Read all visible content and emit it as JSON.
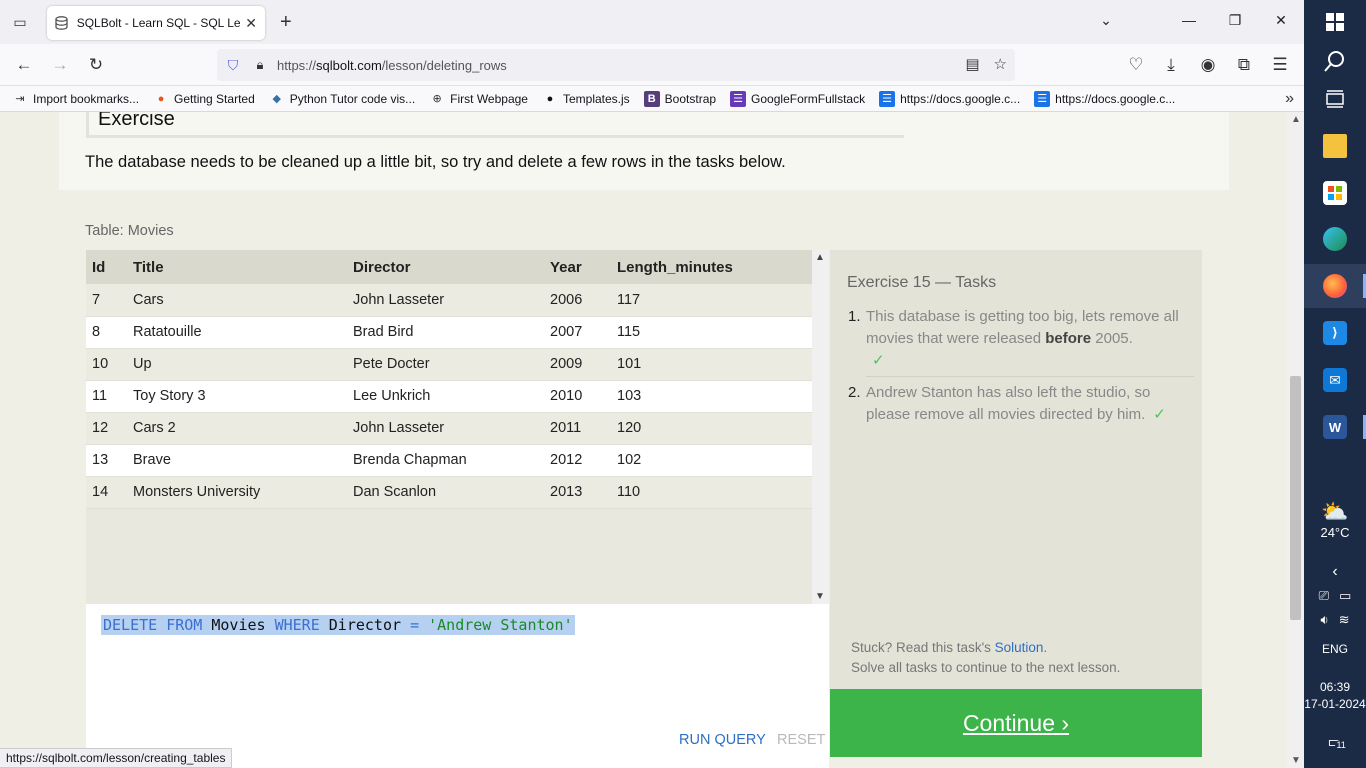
{
  "browser": {
    "tab_title": "SQLBolt - Learn SQL - SQL Less",
    "url_prefix": "https://",
    "url_host": "sqlbolt.com",
    "url_path": "/lesson/deleting_rows",
    "bookmarks": [
      {
        "label": "Import bookmarks...",
        "icon": "import-icon",
        "color": "#333333"
      },
      {
        "label": "Getting Started",
        "icon": "firefox-icon",
        "color": "#e8561f"
      },
      {
        "label": "Python Tutor code vis...",
        "icon": "python-icon",
        "color": "#3572a5"
      },
      {
        "label": "First Webpage",
        "icon": "globe-icon",
        "color": "#333333"
      },
      {
        "label": "Templates.js",
        "icon": "github-icon",
        "color": "#111111"
      },
      {
        "label": "Bootstrap",
        "icon": "bootstrap-icon",
        "color": "#563d7c"
      },
      {
        "label": "GoogleFormFullstack",
        "icon": "forms-icon",
        "color": "#673ab7"
      },
      {
        "label": "https://docs.google.c...",
        "icon": "docs-icon",
        "color": "#1a73e8"
      },
      {
        "label": "https://docs.google.c...",
        "icon": "docs-icon",
        "color": "#1a73e8"
      }
    ],
    "status_url": "https://sqlbolt.com/lesson/creating_tables"
  },
  "page": {
    "exercise_heading": "Exercise",
    "intro": "The database needs to be cleaned up a little bit, so try and delete a few rows in the tasks below.",
    "table_caption": "Table: Movies",
    "table": {
      "columns": [
        "Id",
        "Title",
        "Director",
        "Year",
        "Length_minutes"
      ],
      "rows": [
        [
          "7",
          "Cars",
          "John Lasseter",
          "2006",
          "117"
        ],
        [
          "8",
          "Ratatouille",
          "Brad Bird",
          "2007",
          "115"
        ],
        [
          "10",
          "Up",
          "Pete Docter",
          "2009",
          "101"
        ],
        [
          "11",
          "Toy Story 3",
          "Lee Unkrich",
          "2010",
          "103"
        ],
        [
          "12",
          "Cars 2",
          "John Lasseter",
          "2011",
          "120"
        ],
        [
          "13",
          "Brave",
          "Brenda Chapman",
          "2012",
          "102"
        ],
        [
          "14",
          "Monsters University",
          "Dan Scanlon",
          "2013",
          "110"
        ]
      ]
    },
    "query": {
      "kw1": "DELETE FROM",
      "table": "Movies",
      "kw2": "WHERE",
      "column": "Director",
      "op": "=",
      "value": "'Andrew Stanton'"
    },
    "run_label": "RUN QUERY",
    "reset_label": "RESET",
    "tasks_title": "Exercise 15 — Tasks",
    "tasks": [
      {
        "num": "1.",
        "pre": "This database is getting too big, lets remove all movies that were released ",
        "bold": "before",
        "post": " 2005.",
        "check": "✓"
      },
      {
        "num": "2.",
        "pre": "Andrew Stanton has also left the studio, so please remove all movies directed by him.",
        "bold": "",
        "post": "",
        "check": "✓"
      }
    ],
    "stuck_pre": "Stuck? Read this task's ",
    "stuck_link": "Solution",
    "stuck_post": ".",
    "stuck_line2": "Solve all tasks to continue to the next lesson.",
    "continue_label": "Continue ›"
  },
  "taskbar": {
    "weather_temp": "24°C",
    "language": "ENG",
    "time": "06:39",
    "date": "17-01-2024",
    "notifications": "11"
  }
}
